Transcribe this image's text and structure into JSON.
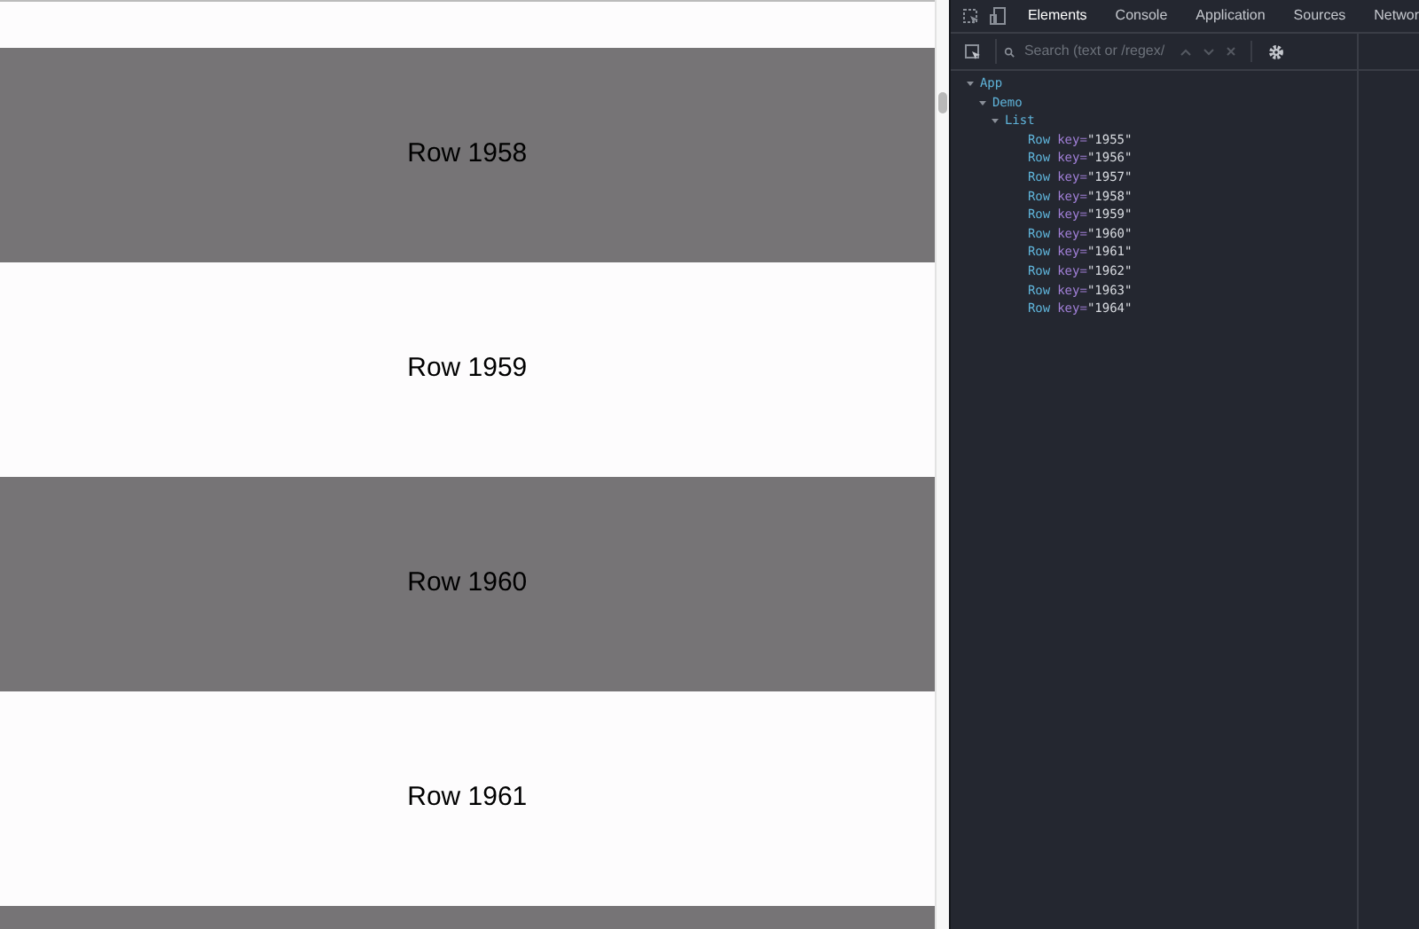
{
  "list": {
    "rows": [
      {
        "kind": "partial",
        "shaded": false
      },
      {
        "kind": "full",
        "shaded": true,
        "label": "Row 1958"
      },
      {
        "kind": "full",
        "shaded": false,
        "label": "Row 1959"
      },
      {
        "kind": "full",
        "shaded": true,
        "label": "Row 1960"
      },
      {
        "kind": "full",
        "shaded": false,
        "label": "Row 1961"
      },
      {
        "kind": "partial",
        "shaded": true
      }
    ]
  },
  "devtools": {
    "tabs": [
      {
        "label": "Elements",
        "selected": true
      },
      {
        "label": "Console",
        "selected": false
      },
      {
        "label": "Application",
        "selected": false
      },
      {
        "label": "Sources",
        "selected": false
      },
      {
        "label": "Networ",
        "selected": false
      }
    ],
    "search": {
      "placeholder": "Search (text or /regex/"
    },
    "tree": [
      {
        "name": "App",
        "expanded": true,
        "children": [
          {
            "name": "Demo",
            "expanded": true,
            "children": [
              {
                "name": "List",
                "expanded": true,
                "children": [
                  {
                    "name": "Row",
                    "attr": "key=",
                    "value": "\"1955\""
                  },
                  {
                    "name": "Row",
                    "attr": "key=",
                    "value": "\"1956\""
                  },
                  {
                    "name": "Row",
                    "attr": "key=",
                    "value": "\"1957\""
                  },
                  {
                    "name": "Row",
                    "attr": "key=",
                    "value": "\"1958\""
                  },
                  {
                    "name": "Row",
                    "attr": "key=",
                    "value": "\"1959\""
                  },
                  {
                    "name": "Row",
                    "attr": "key=",
                    "value": "\"1960\""
                  },
                  {
                    "name": "Row",
                    "attr": "key=",
                    "value": "\"1961\""
                  },
                  {
                    "name": "Row",
                    "attr": "key=",
                    "value": "\"1962\""
                  },
                  {
                    "name": "Row",
                    "attr": "key=",
                    "value": "\"1963\""
                  },
                  {
                    "name": "Row",
                    "attr": "key=",
                    "value": "\"1964\""
                  }
                ]
              }
            ]
          }
        ]
      }
    ]
  }
}
